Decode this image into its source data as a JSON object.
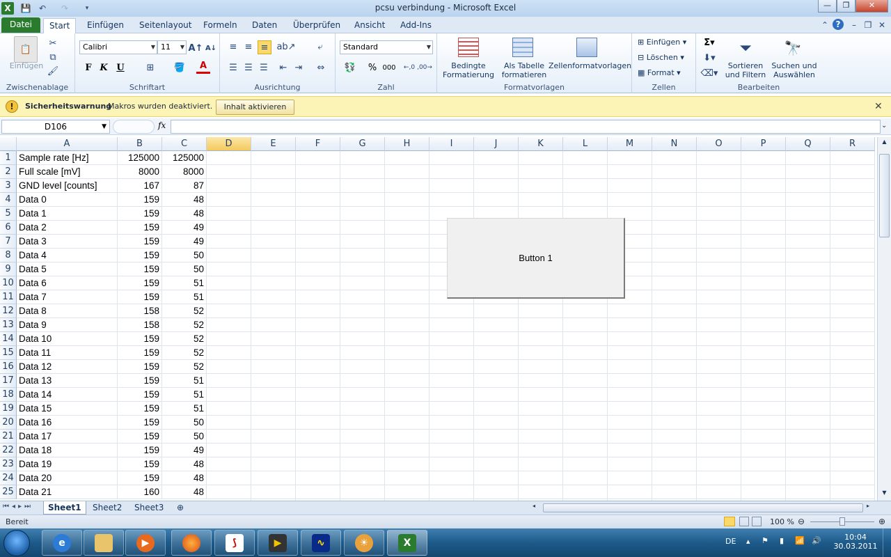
{
  "window": {
    "title": "pcsu verbindung  -  Microsoft Excel",
    "minimize": "—",
    "maximize": "❐",
    "close": "✕"
  },
  "tabs": [
    {
      "label": "Datei"
    },
    {
      "label": "Start"
    },
    {
      "label": "Einfügen"
    },
    {
      "label": "Seitenlayout"
    },
    {
      "label": "Formeln"
    },
    {
      "label": "Daten"
    },
    {
      "label": "Überprüfen"
    },
    {
      "label": "Ansicht"
    },
    {
      "label": "Add-Ins"
    }
  ],
  "ribbon": {
    "clipboard": {
      "label": "Zwischenablage",
      "paste": "Einfügen"
    },
    "font": {
      "label": "Schriftart",
      "name": "Calibri",
      "size": "11",
      "bold": "F",
      "italic": "K",
      "underline": "U"
    },
    "alignment": {
      "label": "Ausrichtung"
    },
    "number": {
      "label": "Zahl",
      "format": "Standard",
      "percent": "%",
      "thousands": "000"
    },
    "styles": {
      "label": "Formatvorlagen",
      "conditional_1": "Bedingte",
      "conditional_2": "Formatierung",
      "astable_1": "Als Tabelle",
      "astable_2": "formatieren",
      "cellstyles": "Zellenformatvorlagen"
    },
    "cells": {
      "label": "Zellen",
      "insert": "Einfügen",
      "delete": "Löschen",
      "format": "Format"
    },
    "editing": {
      "label": "Bearbeiten",
      "sort_1": "Sortieren",
      "sort_2": "und Filtern",
      "find_1": "Suchen und",
      "find_2": "Auswählen"
    }
  },
  "message_bar": {
    "title": "Sicherheitswarnung",
    "text": "Makros wurden deaktiviert.",
    "button": "Inhalt aktivieren"
  },
  "formula_bar": {
    "name_box": "D106",
    "fx": "fx",
    "value": ""
  },
  "columns": [
    "A",
    "B",
    "C",
    "D",
    "E",
    "F",
    "G",
    "H",
    "I",
    "J",
    "K",
    "L",
    "M",
    "N",
    "O",
    "P",
    "Q",
    "R"
  ],
  "selected_column": "D",
  "rows": [
    {
      "n": "1",
      "a": "Sample rate [Hz]",
      "b": "125000",
      "c": "125000"
    },
    {
      "n": "2",
      "a": "Full scale [mV]",
      "b": "8000",
      "c": "8000"
    },
    {
      "n": "3",
      "a": "GND level [counts]",
      "b": "167",
      "c": "87"
    },
    {
      "n": "4",
      "a": "Data 0",
      "b": "159",
      "c": "48"
    },
    {
      "n": "5",
      "a": "Data 1",
      "b": "159",
      "c": "48"
    },
    {
      "n": "6",
      "a": "Data 2",
      "b": "159",
      "c": "49"
    },
    {
      "n": "7",
      "a": "Data 3",
      "b": "159",
      "c": "49"
    },
    {
      "n": "8",
      "a": "Data 4",
      "b": "159",
      "c": "50"
    },
    {
      "n": "9",
      "a": "Data 5",
      "b": "159",
      "c": "50"
    },
    {
      "n": "10",
      "a": "Data 6",
      "b": "159",
      "c": "51"
    },
    {
      "n": "11",
      "a": "Data 7",
      "b": "159",
      "c": "51"
    },
    {
      "n": "12",
      "a": "Data 8",
      "b": "158",
      "c": "52"
    },
    {
      "n": "13",
      "a": "Data 9",
      "b": "158",
      "c": "52"
    },
    {
      "n": "14",
      "a": "Data 10",
      "b": "159",
      "c": "52"
    },
    {
      "n": "15",
      "a": "Data 11",
      "b": "159",
      "c": "52"
    },
    {
      "n": "16",
      "a": "Data 12",
      "b": "159",
      "c": "52"
    },
    {
      "n": "17",
      "a": "Data 13",
      "b": "159",
      "c": "51"
    },
    {
      "n": "18",
      "a": "Data 14",
      "b": "159",
      "c": "51"
    },
    {
      "n": "19",
      "a": "Data 15",
      "b": "159",
      "c": "51"
    },
    {
      "n": "20",
      "a": "Data 16",
      "b": "159",
      "c": "50"
    },
    {
      "n": "21",
      "a": "Data 17",
      "b": "159",
      "c": "50"
    },
    {
      "n": "22",
      "a": "Data 18",
      "b": "159",
      "c": "49"
    },
    {
      "n": "23",
      "a": "Data 19",
      "b": "159",
      "c": "48"
    },
    {
      "n": "24",
      "a": "Data 20",
      "b": "159",
      "c": "48"
    },
    {
      "n": "25",
      "a": "Data 21",
      "b": "160",
      "c": "48"
    }
  ],
  "form_button": {
    "label": "Button 1"
  },
  "sheets": [
    {
      "label": "Sheet1"
    },
    {
      "label": "Sheet2"
    },
    {
      "label": "Sheet3"
    }
  ],
  "status": {
    "ready": "Bereit",
    "zoom": "100 %"
  },
  "taskbar": {
    "language": "DE",
    "time": "10:04",
    "date": "30.03.2011"
  },
  "colors": {
    "excel_green": "#2a7b2d",
    "warning_bar": "#fcf4b6",
    "selected_header": "#f5c95c"
  }
}
